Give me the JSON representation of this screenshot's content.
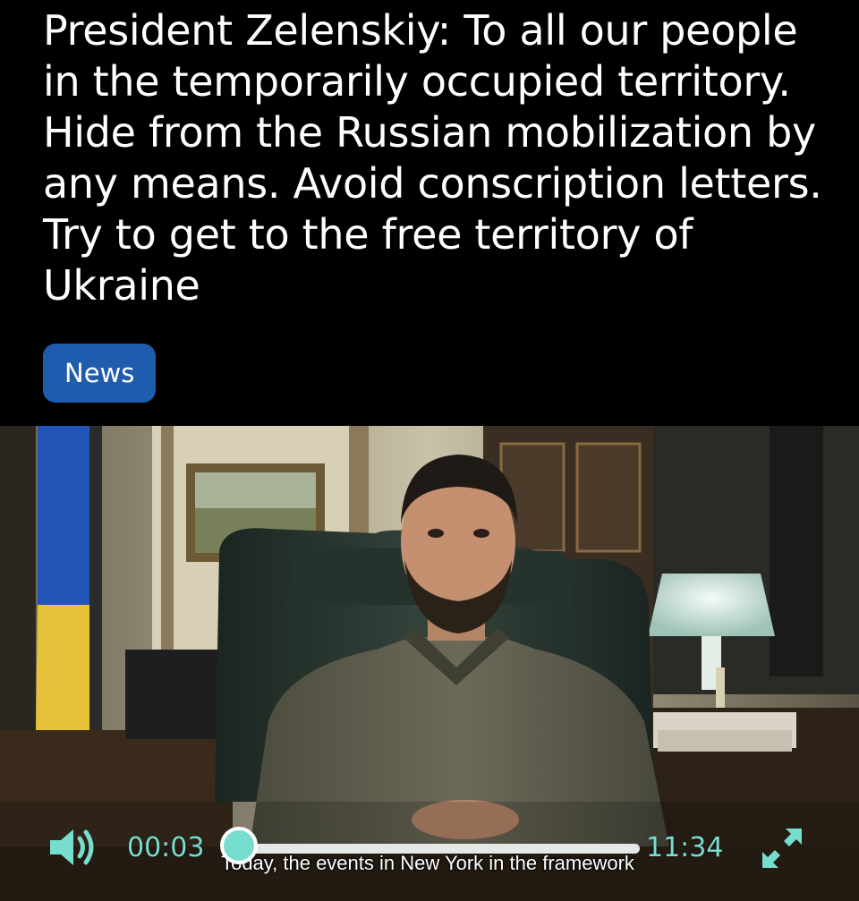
{
  "post": {
    "headline": "President Zelenskiy: To all our people in the temporarily occupied territory. Hide from the Russian mobilization by any means. Avoid conscription letters. Try to get to the free territory of Ukraine",
    "tag": "News"
  },
  "video": {
    "subtitle": "Today, the events in New York in the framework",
    "current_time": "00:03",
    "total_time": "11:34",
    "progress": 0.004,
    "icons": {
      "volume": "volume-icon",
      "fullscreen": "fullscreen-expand-icon"
    },
    "accent_color": "#77ddcf",
    "track_color": "#e6e8e8"
  }
}
